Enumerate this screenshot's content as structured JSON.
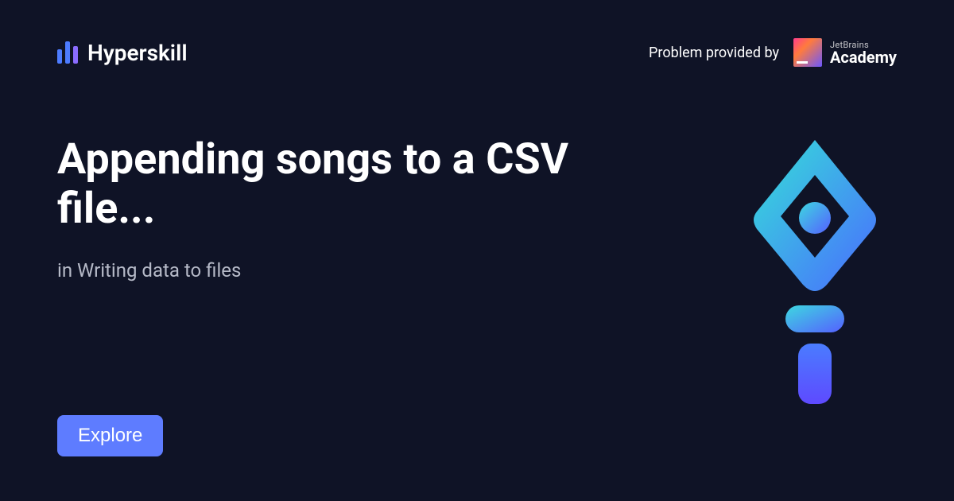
{
  "brand": {
    "name": "Hyperskill"
  },
  "provider": {
    "prefix": "Problem provided by",
    "small": "JetBrains",
    "big": "Academy"
  },
  "page": {
    "title": "Appending songs to a CSV file...",
    "subtitle": "in Writing data to files"
  },
  "cta": {
    "label": "Explore"
  }
}
